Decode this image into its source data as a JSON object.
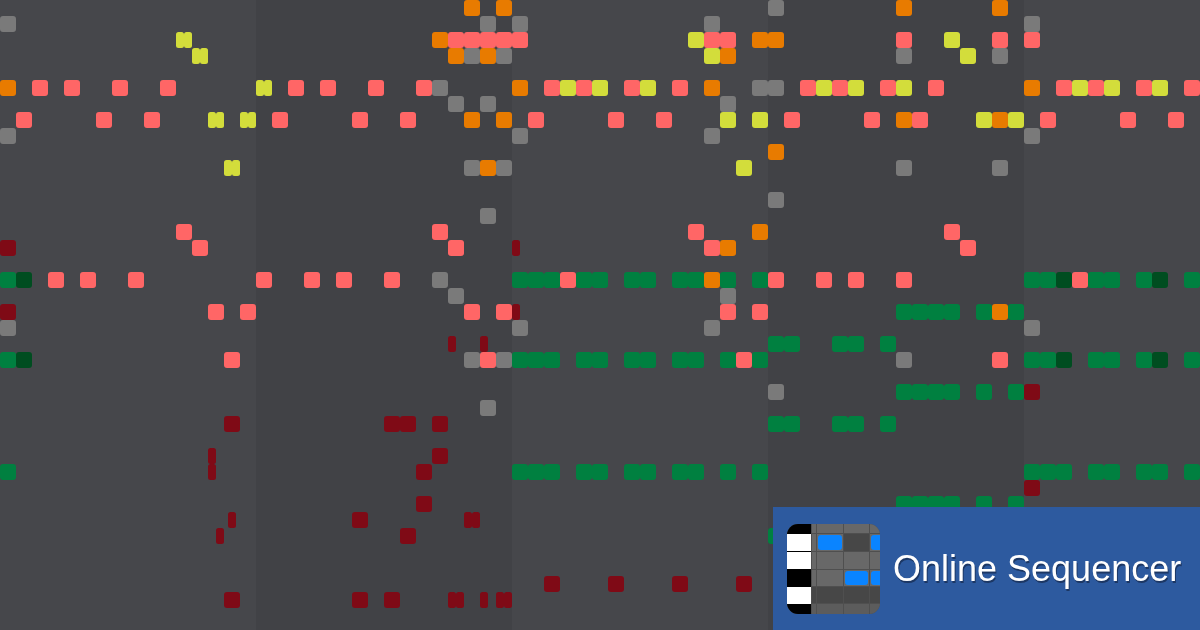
{
  "banner": {
    "title": "Online Sequencer"
  }
}
